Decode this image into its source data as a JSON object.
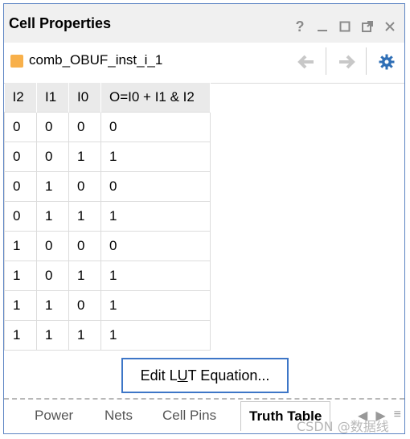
{
  "window": {
    "title": "Cell Properties"
  },
  "cell": {
    "name": "comb_OBUF_inst_i_1",
    "swatch_color": "#f8b04a"
  },
  "truth_table": {
    "headers": [
      "I2",
      "I1",
      "I0",
      "O=I0 + I1 & I2"
    ],
    "rows": [
      [
        "0",
        "0",
        "0",
        "0"
      ],
      [
        "0",
        "0",
        "1",
        "1"
      ],
      [
        "0",
        "1",
        "0",
        "0"
      ],
      [
        "0",
        "1",
        "1",
        "1"
      ],
      [
        "1",
        "0",
        "0",
        "0"
      ],
      [
        "1",
        "0",
        "1",
        "1"
      ],
      [
        "1",
        "1",
        "0",
        "1"
      ],
      [
        "1",
        "1",
        "1",
        "1"
      ]
    ]
  },
  "edit_button": {
    "prefix": "Edit L",
    "underlined": "U",
    "suffix": "T Equation..."
  },
  "tabs": [
    {
      "label": "Power"
    },
    {
      "label": "Nets"
    },
    {
      "label": "Cell Pins"
    },
    {
      "label": "Truth Table",
      "active": true
    }
  ],
  "watermark": "CSDN @数据线",
  "icons": {
    "help": "?",
    "minimize": "minimize-icon",
    "maximize": "maximize-icon",
    "float": "float-icon",
    "close": "close-icon",
    "back": "back-arrow-icon",
    "forward": "forward-arrow-icon",
    "settings": "gear-icon"
  },
  "colors": {
    "accent_blue": "#3d76c7",
    "gear_blue": "#2f6fb6",
    "arrow_gray": "#c8c8c8"
  }
}
